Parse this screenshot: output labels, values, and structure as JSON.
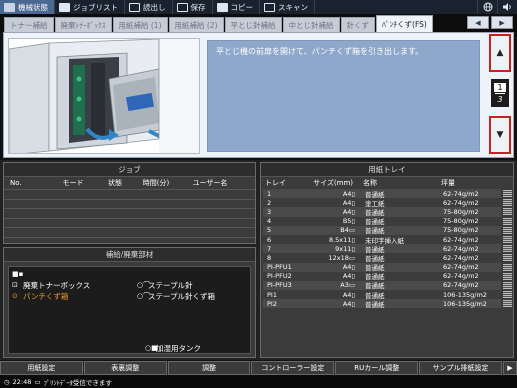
{
  "top_tabs": [
    {
      "label": "機械状態",
      "active": true,
      "icon": "machine-icon"
    },
    {
      "label": "ジョブリスト",
      "active": false,
      "icon": "job-list-icon"
    },
    {
      "label": "読出し",
      "active": false,
      "icon": "recall-icon"
    },
    {
      "label": "保存",
      "active": false,
      "icon": "save-icon"
    },
    {
      "label": "コピー",
      "active": false,
      "icon": "copy-icon"
    },
    {
      "label": "スキャン",
      "active": false,
      "icon": "scan-icon"
    }
  ],
  "top_icons": {
    "globe": "globe-icon",
    "volume": "volume-icon"
  },
  "sub_tabs": [
    {
      "label": "トナー補給",
      "active": false
    },
    {
      "label": "廃棄ﾄﾅｰﾎﾞｯｸｽ",
      "active": false
    },
    {
      "label": "用紙補給 (1)",
      "active": false
    },
    {
      "label": "用紙補給 (2)",
      "active": false
    },
    {
      "label": "平とじ針補給",
      "active": false
    },
    {
      "label": "中とじ針補給",
      "active": false
    },
    {
      "label": "針くず",
      "active": false
    },
    {
      "label": "ﾊﾟﾝﾁくず(FS)",
      "active": true
    }
  ],
  "tab_nav": {
    "prev": "◀",
    "next": "▶"
  },
  "instruction": "平とじ機の前扉を開けて、パンチくず箱を引き出します。",
  "page_indicator": {
    "current": "1",
    "total": "3"
  },
  "scroll": {
    "up": "▲",
    "down": "▼"
  },
  "job_panel": {
    "title": "ジョブ",
    "columns": [
      "No.",
      "モード",
      "状態",
      "時間(分)",
      "ユーザー名"
    ]
  },
  "supply_panel": {
    "title": "補給/廃棄部材",
    "items": [
      {
        "label": "廃棄トナーボックス",
        "icon": "waste-toner-icon",
        "warning": false
      },
      {
        "label": "パンチくず箱",
        "icon": "punch-waste-icon",
        "warning": true
      },
      {
        "label": "ステープル針",
        "icon": "staple-icon",
        "warning": false
      },
      {
        "label": "ステープル針くず箱",
        "icon": "staple-waste-icon",
        "warning": false
      },
      {
        "label": "加湿用タンク",
        "icon": "tank-icon",
        "warning": false
      }
    ]
  },
  "paper_panel": {
    "title": "用紙トレイ",
    "columns": [
      "トレイ",
      "サイズ(mm)",
      "名称",
      "坪量"
    ],
    "rows": [
      {
        "tray": "1",
        "size": "A4▯",
        "name": "普通紙",
        "weight": "62-74g/m2"
      },
      {
        "tray": "2",
        "size": "A4▯",
        "name": "塗工紙",
        "weight": "62-74g/m2"
      },
      {
        "tray": "3",
        "size": "A4▯",
        "name": "普通紙",
        "weight": "75-80g/m2"
      },
      {
        "tray": "4",
        "size": "B5▯",
        "name": "普通紙",
        "weight": "75-80g/m2"
      },
      {
        "tray": "5",
        "size": "B4▭",
        "name": "普通紙",
        "weight": "75-80g/m2"
      },
      {
        "tray": "6",
        "size": "8.5x11▯",
        "name": "未印字挿入紙",
        "weight": "62-74g/m2"
      },
      {
        "tray": "7",
        "size": "9x11▯",
        "name": "普通紙",
        "weight": "62-74g/m2"
      },
      {
        "tray": "8",
        "size": "12x18▭",
        "name": "普通紙",
        "weight": "62-74g/m2"
      },
      {
        "tray": "PI-PFU1",
        "size": "A4▯",
        "name": "普通紙",
        "weight": "62-74g/m2"
      },
      {
        "tray": "PI-PFU2",
        "size": "A4▯",
        "name": "普通紙",
        "weight": "62-74g/m2"
      },
      {
        "tray": "PI-PFU3",
        "size": "A3▭",
        "name": "普通紙",
        "weight": "62-74g/m2"
      },
      {
        "tray": "PI1",
        "size": "A4▯",
        "name": "普通紙",
        "weight": "106-135g/m2"
      },
      {
        "tray": "PI2",
        "size": "A4▯",
        "name": "普通紙",
        "weight": "106-135g/m2"
      }
    ]
  },
  "bottom_buttons": [
    "用紙設定",
    "表裏調整",
    "調整",
    "コントローラー設定",
    "RUカール調整",
    "サンプル排紙設定"
  ],
  "bottom_next": "▶",
  "status": {
    "time": "22:48",
    "message": "ﾌﾟﾘﾝﾄﾃﾞｰﾀ受信できます"
  },
  "colors": {
    "accent": "#4a6890",
    "warning": "#e89a2a",
    "highlight_border": "#cc2020",
    "instruction_bg": "#8ea8cc"
  }
}
